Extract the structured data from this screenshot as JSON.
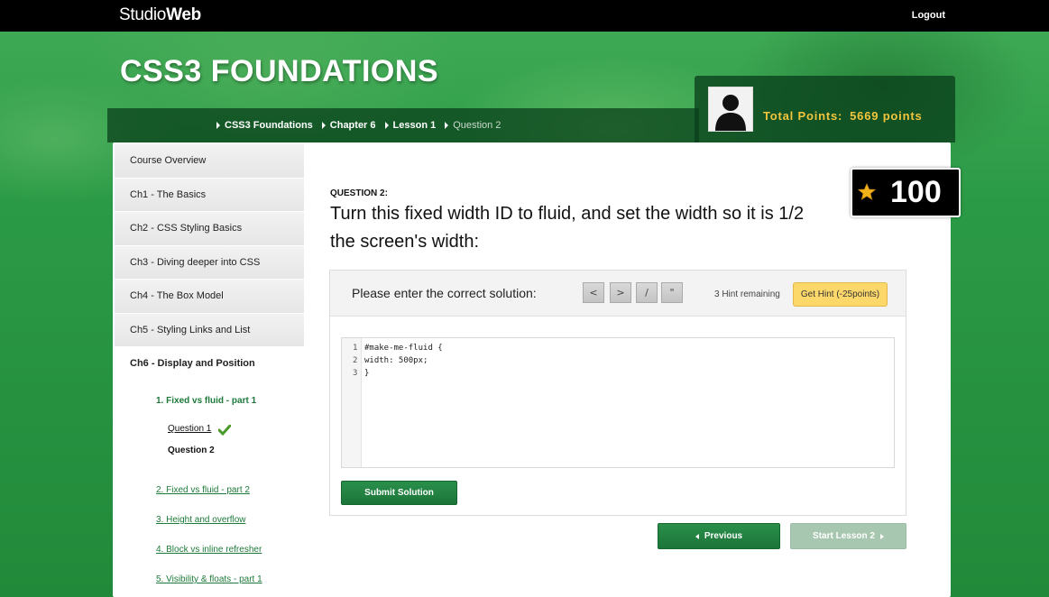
{
  "header": {
    "logo_prefix": "Studio",
    "logo_suffix": "Web",
    "logout": "Logout",
    "course_title": "CSS3 FOUNDATIONS"
  },
  "breadcrumb": [
    "CSS3 Foundations",
    "Chapter 6",
    "Lesson 1",
    "Question 2"
  ],
  "points": {
    "label": "Total Points:",
    "value": "5669 points"
  },
  "sidebar": {
    "items": [
      {
        "label": "Course Overview"
      },
      {
        "label": "Ch1 - The Basics"
      },
      {
        "label": "Ch2 - CSS Styling Basics"
      },
      {
        "label": "Ch3 - Diving deeper into CSS"
      },
      {
        "label": "Ch4 - The Box Model"
      },
      {
        "label": "Ch5 - Styling Links and List"
      },
      {
        "label": "Ch6 - Display and Position"
      }
    ],
    "lessons": [
      {
        "label": "1. Fixed vs fluid - part 1"
      },
      {
        "label": "2. Fixed vs fluid - part 2"
      },
      {
        "label": "3. Height and overflow"
      },
      {
        "label": "4. Block vs inline refresher"
      },
      {
        "label": "5. Visibility & floats - part 1"
      }
    ],
    "questions": [
      {
        "label": "Question 1"
      },
      {
        "label": "Question 2"
      }
    ]
  },
  "question": {
    "label": "QUESTION 2:",
    "text": "Turn this fixed width ID to fluid, and set the width so it is 1/2 the screen's width:",
    "score": "100"
  },
  "answer": {
    "prompt": "Please enter the correct solution:",
    "symbols": [
      "<",
      ">",
      "/",
      "\""
    ],
    "hints_remaining": "3 Hint remaining",
    "hint_button": "Get Hint (-25points)",
    "code_lines": [
      "#make-me-fluid {",
      "width: 500px;",
      "}"
    ],
    "line_numbers": [
      "1",
      "2",
      "3"
    ],
    "submit": "Submit Solution"
  },
  "nav": {
    "previous": "Previous",
    "next": "Start Lesson 2"
  },
  "colors": {
    "brand_green": "#1c7539",
    "accent_gold": "#f2c53d",
    "hint_yellow": "#fcd86b"
  }
}
